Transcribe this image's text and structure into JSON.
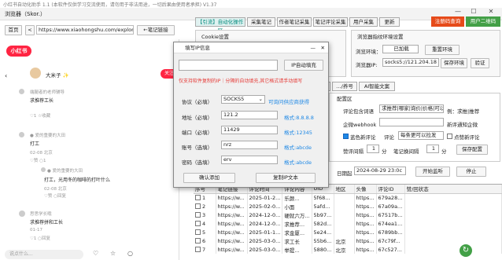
{
  "window": {
    "title": "小红书自动化助手 1.1  (本软件仅供学习交流使用，请勿用于非法用途，一切后果由使用者承担)  V1.37",
    "subtitle": "浏览器（Skor.）"
  },
  "browser": {
    "home_label": "首页",
    "back_label": "<",
    "url": "https://www.xiaohongshu.com/explor",
    "prev_label": "←笔记链接",
    "logo": "小红书",
    "follow_label": "关注"
  },
  "feed": [
    {
      "author": "大米子 ✨",
      "text": "",
      "meta": ""
    },
    {
      "author": "",
      "text": "端腿者的老师辅导",
      "meta": "求推荐工长"
    },
    {
      "author": "",
      "text": "♡1  ☆收藏",
      "meta": ""
    },
    {
      "author": "",
      "text": "● 爱的重要的大田",
      "meta": "打工"
    },
    {
      "author": "",
      "text": "02-08 北京",
      "meta": "♡赞  ○1"
    },
    {
      "author": "",
      "text": "● 爱的重要的大田",
      "meta": "打工，光用冬的咖啡的打叶什么"
    },
    {
      "author": "",
      "text": "02-08 北京",
      "meta": "♡赞  ○回复"
    },
    {
      "author": "",
      "text": "思思学长哦",
      "meta": "求推荐拼和工长"
    },
    {
      "author": "",
      "text": "01-17",
      "meta": "♡1  ○回复"
    }
  ],
  "feed_input_placeholder": "说点什么...",
  "right_tabs": [
    "【引流】自动化操作区",
    "采集笔记",
    "作者笔记采集",
    "笔记评论采集",
    "用户采集",
    "更新"
  ],
  "top_buttons": {
    "reg": "注册码查询",
    "user": "用户二维码"
  },
  "cookie_group": "Cookie设置",
  "env_group": {
    "title": "浏览器指纹环境设置",
    "env_label": "浏览环境：",
    "env_value": "已加载",
    "reset_label": "重置环境",
    "ip_label": "浏览器IP:",
    "ip_value": "socks5://121.204.18",
    "save_env": "保存环境",
    "verify": "验证"
  },
  "dialog": {
    "title": "填写IP信息",
    "auto_fill": "IP自动填充",
    "warning": "仅支持软件复制的IP｜分隔的自动填充,其它格式请手动填写",
    "protocol_label": "协议（必填）",
    "protocol_value": "SOCKS5",
    "protocol_link": "可询问供应商获得",
    "host_label": "地址（必填）",
    "host_value": "121.2",
    "host_hint": "格式:8.8.8.8",
    "port_label": "端口（必填）",
    "port_value": "11429",
    "port_hint": "格式:12345",
    "user_label": "账号（选填）",
    "user_value": "nrz",
    "user_hint": "格式:abcde",
    "pass_label": "密码（选填）",
    "pass_value": "erv",
    "pass_hint": "格式:abcde",
    "confirm": "确认添加",
    "copy": "复制IP文本"
  },
  "sub_tabs": [
    "评论",
    "上",
    "…/养号",
    "AI智能文案"
  ],
  "config": {
    "title": "配置区",
    "comment_kw_label": "评论包含词语",
    "comment_kw_value": "求推荐|哪家|询价|价格|可以",
    "comment_kw_hint": "例：求推|推荐",
    "webhook_label": "企微webhook",
    "webhook_hint": "新评通知企微",
    "opt1": "蓝色新评论",
    "opt2": "评论",
    "opt3": "每条更可以拉发",
    "opt4": "点赞新评论",
    "like_interval": "赞评间隔",
    "like_val": "1",
    "fen": "分",
    "note_interval": "笔记换间隔",
    "note_val": "1",
    "fen2": "分",
    "save": "保存配置"
  },
  "date_row": {
    "label": "日期起",
    "value": "2024-08-29 23:0c",
    "start": "开始监听",
    "stop": "停止"
  },
  "grid": {
    "headers": [
      "序号",
      "笔记链接",
      "评论时间",
      "评论内容",
      "UID",
      "地区",
      "头像",
      "评论ID",
      "赞/回状态"
    ],
    "rows": [
      [
        "1",
        "https://w...",
        "2025-01-2...",
        "乐颜...",
        "5f68...",
        "",
        "https...",
        "679a28...",
        ""
      ],
      [
        "2",
        "https://w...",
        "2025-02-0...",
        "小面",
        "5afd...",
        "",
        "https...",
        "67a09a...",
        ""
      ],
      [
        "3",
        "https://w...",
        "2024-12-0...",
        "硬就六万...",
        "5b97...",
        "",
        "https...",
        "67517b...",
        ""
      ],
      [
        "4",
        "https://w...",
        "2024-12-0...",
        "求推荐...",
        "582d...",
        "",
        "https...",
        "674ea1...",
        ""
      ],
      [
        "5",
        "https://w...",
        "2025-01-1...",
        "求金厦...",
        "5e24...",
        "",
        "https...",
        "6789bb...",
        ""
      ],
      [
        "6",
        "https://w...",
        "2025-03-0...",
        "求工长",
        "55b6...",
        "北京",
        "https...",
        "67c79f...",
        ""
      ],
      [
        "7",
        "https://w...",
        "2025-03-0...",
        "举提...",
        "5880...",
        "北京",
        "https...",
        "67c527...",
        ""
      ]
    ]
  }
}
